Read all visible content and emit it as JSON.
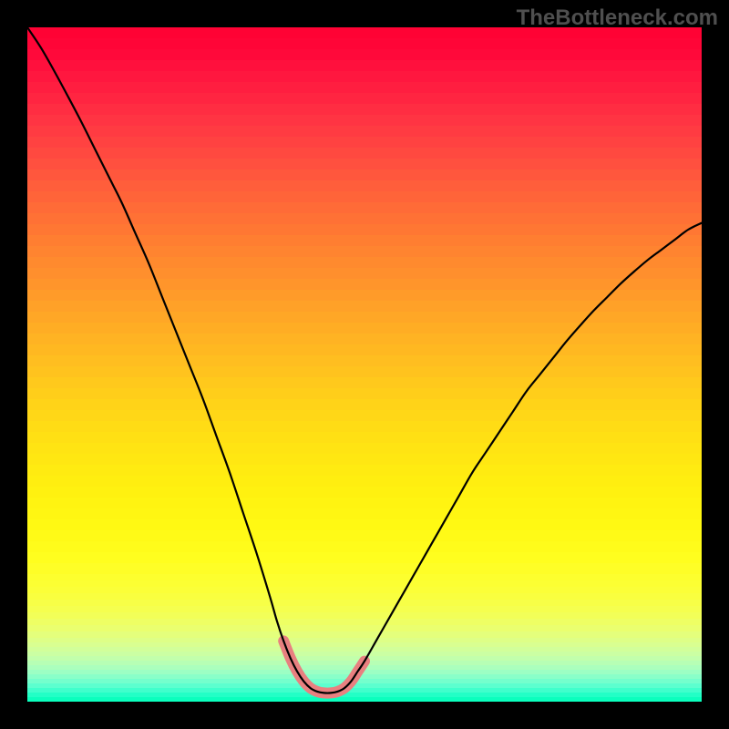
{
  "watermark": "TheBottleneck.com",
  "chart_data": {
    "type": "line",
    "title": "",
    "xlabel": "",
    "ylabel": "",
    "xlim": [
      0,
      100
    ],
    "ylim": [
      0,
      100
    ],
    "series": [
      {
        "name": "curve",
        "x": [
          0,
          2,
          4,
          6,
          8,
          10,
          12,
          14,
          16,
          18,
          20,
          22,
          24,
          26,
          28,
          30,
          32,
          34,
          36,
          37,
          38,
          39,
          40,
          41,
          42,
          43,
          44,
          45,
          46,
          47,
          48,
          49,
          50,
          52,
          54,
          56,
          58,
          60,
          62,
          64,
          66,
          68,
          70,
          72,
          74,
          76,
          78,
          80,
          82,
          84,
          86,
          88,
          90,
          92,
          94,
          96,
          98,
          100
        ],
        "y": [
          100,
          97,
          93.5,
          89.8,
          86,
          82,
          78,
          74,
          69.5,
          65,
          60,
          55,
          50,
          45,
          39.5,
          34,
          28,
          22,
          15.5,
          12,
          9,
          6.5,
          4.5,
          3,
          2,
          1.5,
          1.3,
          1.3,
          1.5,
          2,
          3,
          4.5,
          6,
          9.5,
          13,
          16.5,
          20,
          23.5,
          27,
          30.5,
          34,
          37,
          40,
          43,
          46,
          48.5,
          51,
          53.5,
          55.8,
          58,
          60,
          62,
          63.8,
          65.5,
          67,
          68.5,
          70,
          71
        ]
      },
      {
        "name": "flat-marker",
        "x": [
          38,
          39,
          40,
          41,
          42,
          43,
          44,
          45,
          46,
          47,
          48,
          49,
          50
        ],
        "y": [
          9,
          6.5,
          4.5,
          3,
          2,
          1.5,
          1.3,
          1.3,
          1.5,
          2,
          3,
          4.5,
          6
        ]
      }
    ],
    "gradient_stops": [
      {
        "pos": 0.0,
        "color": "#ff0033"
      },
      {
        "pos": 0.04,
        "color": "#ff093a"
      },
      {
        "pos": 0.08,
        "color": "#ff1a40"
      },
      {
        "pos": 0.14,
        "color": "#ff3543"
      },
      {
        "pos": 0.2,
        "color": "#ff4f3f"
      },
      {
        "pos": 0.26,
        "color": "#ff6838"
      },
      {
        "pos": 0.32,
        "color": "#ff7f31"
      },
      {
        "pos": 0.38,
        "color": "#ff952b"
      },
      {
        "pos": 0.44,
        "color": "#ffab25"
      },
      {
        "pos": 0.5,
        "color": "#ffc01f"
      },
      {
        "pos": 0.56,
        "color": "#ffd318"
      },
      {
        "pos": 0.62,
        "color": "#ffe313"
      },
      {
        "pos": 0.68,
        "color": "#fff010"
      },
      {
        "pos": 0.74,
        "color": "#fff913"
      },
      {
        "pos": 0.79,
        "color": "#fffe20"
      },
      {
        "pos": 0.835,
        "color": "#fbff38"
      },
      {
        "pos": 0.87,
        "color": "#f3ff55"
      },
      {
        "pos": 0.895,
        "color": "#e8ff74"
      },
      {
        "pos": 0.915,
        "color": "#daff90"
      },
      {
        "pos": 0.932,
        "color": "#c8ffa7"
      },
      {
        "pos": 0.946,
        "color": "#b2ffba"
      },
      {
        "pos": 0.958,
        "color": "#98ffc6"
      },
      {
        "pos": 0.968,
        "color": "#7affcd"
      },
      {
        "pos": 0.977,
        "color": "#5affcf"
      },
      {
        "pos": 0.985,
        "color": "#38ffcb"
      },
      {
        "pos": 0.993,
        "color": "#16ffc2"
      },
      {
        "pos": 1.0,
        "color": "#00ffb8"
      }
    ],
    "flat_marker_color": "#e88080",
    "curve_color": "#000000"
  }
}
